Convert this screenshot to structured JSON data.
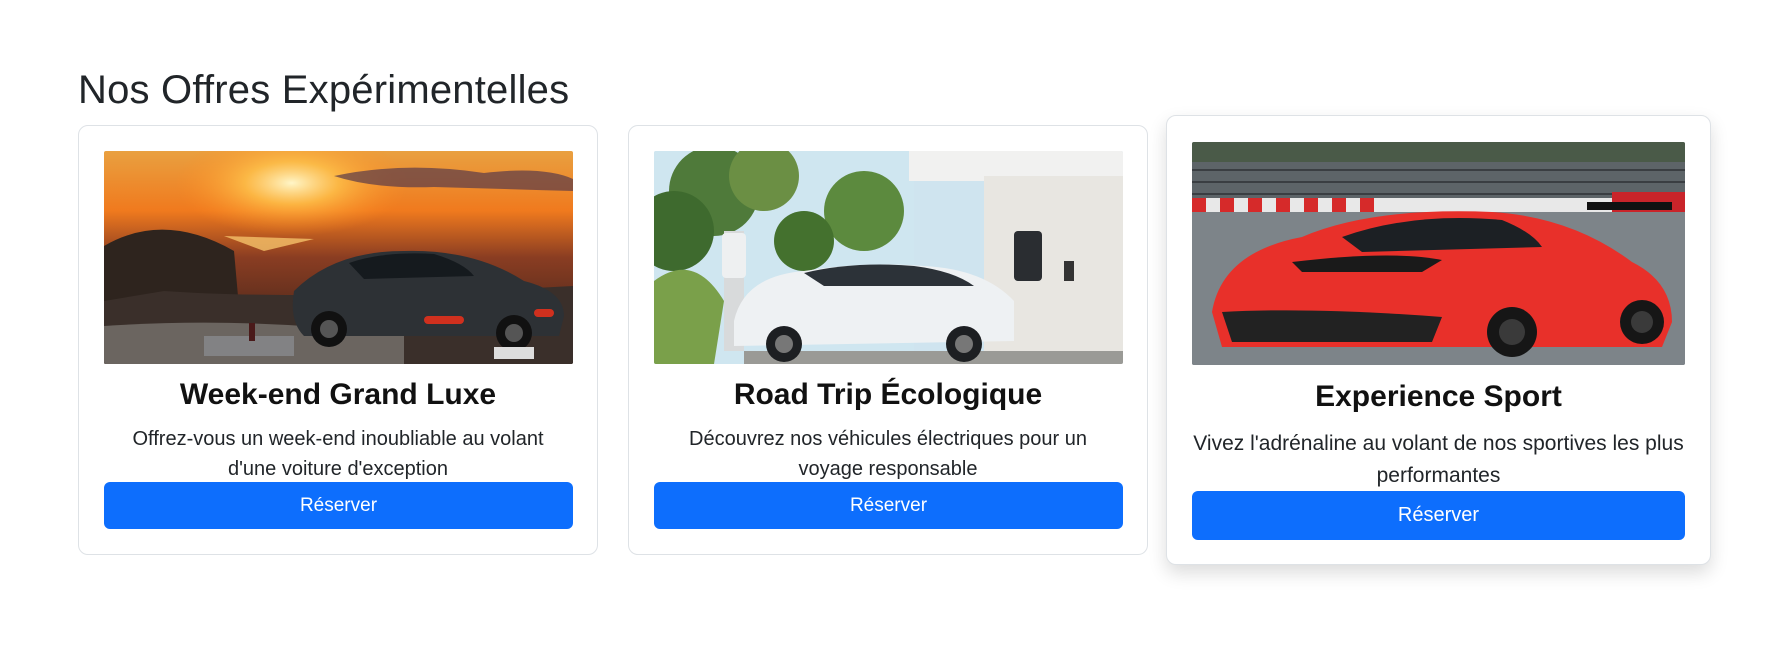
{
  "section": {
    "title": "Nos Offres Expérimentelles"
  },
  "offers": [
    {
      "title": "Week-end Grand Luxe",
      "description": "Offrez-vous un week-end inoubliable au volant d'une voiture d'exception",
      "button_label": "Réserver",
      "image": "sunset-luxury-car-photo"
    },
    {
      "title": "Road Trip Écologique",
      "description": "Découvrez nos véhicules électriques pour un voyage responsable",
      "button_label": "Réserver",
      "image": "electric-car-charging-photo"
    },
    {
      "title": "Experience Sport",
      "description": "Vivez l'adrénaline au volant de nos sportives les plus performantes",
      "button_label": "Réserver",
      "image": "red-sports-car-track-photo"
    }
  ],
  "colors": {
    "primary": "#0d6efd",
    "text": "#212529",
    "border": "#dee2e6"
  }
}
